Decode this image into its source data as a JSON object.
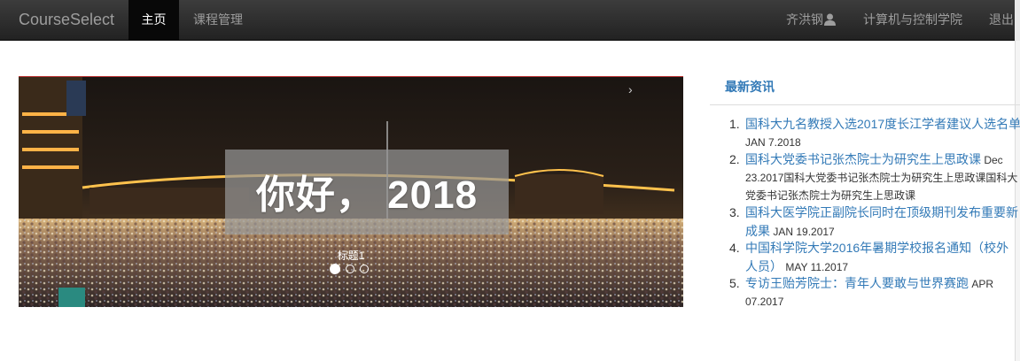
{
  "navbar": {
    "brand": "CourseSelect",
    "home": "主页",
    "course_manage": "课程管理",
    "user_name": "齐洪钢",
    "college": "计算机与控制学院",
    "logout": "退出"
  },
  "carousel": {
    "caption_big": "你好， 2018",
    "caption_label": "标题1",
    "next_arrow": "›",
    "slide_count": 3,
    "active_index": 0
  },
  "news": {
    "title": "最新资讯",
    "items": [
      {
        "num": "1.",
        "title": "国科大九名教授入选2017度长江学者建议人选名单",
        "date": "JAN 7.2018"
      },
      {
        "num": "2.",
        "title": "国科大党委书记张杰院士为研究生上思政课",
        "date": "Dec 23.2017国科大党委书记张杰院士为研究生上思政课国科大党委书记张杰院士为研究生上思政课"
      },
      {
        "num": "3.",
        "title": "国科大医学院正副院长同时在顶级期刊发布重要新成果",
        "date": "JAN 19.2017"
      },
      {
        "num": "4.",
        "title": "中国科学院大学2016年暑期学校报名通知（校外人员）",
        "date": "MAY 11.2017"
      },
      {
        "num": "5.",
        "title": "专访王贻芳院士：青年人要敢与世界赛跑",
        "date": "APR 07.2017"
      }
    ]
  },
  "colors": {
    "navbar_bg": "#222222",
    "link": "#337ab7",
    "active_nav_bg": "#080808"
  }
}
